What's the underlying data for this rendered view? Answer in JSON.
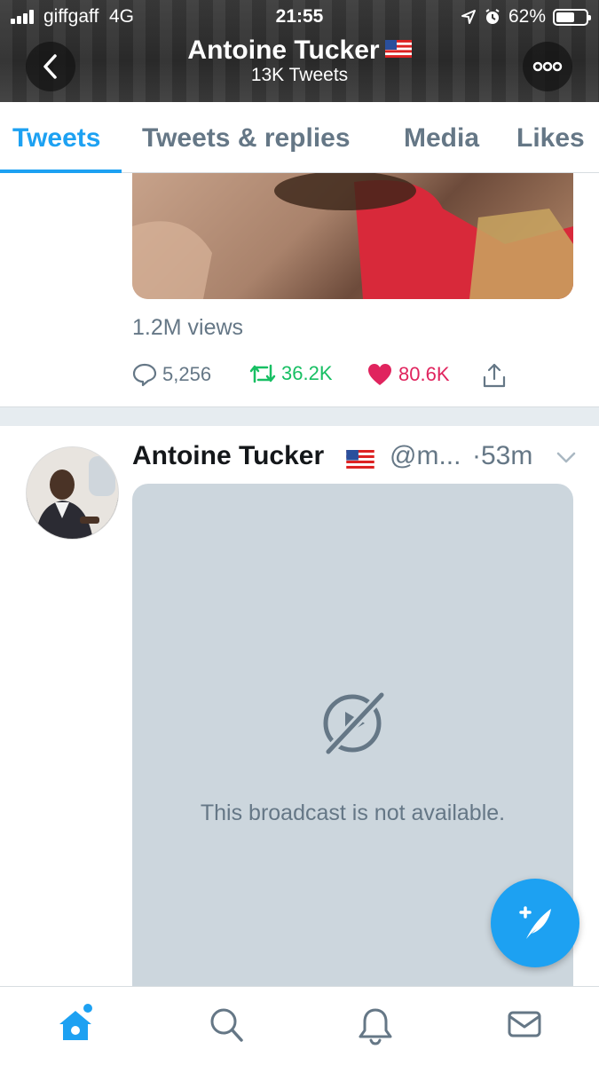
{
  "status_bar": {
    "carrier": "giffgaff",
    "network": "4G",
    "time": "21:55",
    "battery": "62%",
    "battery_level": 0.62
  },
  "header": {
    "name": "Antoine Tucker",
    "tweet_count": "13K Tweets",
    "back_icon": "chevron-left-icon",
    "more_icon": "more-dots-icon"
  },
  "tabs": [
    {
      "label": "Tweets",
      "active": true
    },
    {
      "label": "Tweets & replies",
      "active": false
    },
    {
      "label": "Media",
      "active": false
    },
    {
      "label": "Likes",
      "active": false
    }
  ],
  "tweet1": {
    "views": "1.2M views",
    "replies": "5,256",
    "retweets": "36.2K",
    "likes": "80.6K"
  },
  "tweet2": {
    "name": "Antoine Tucker",
    "handle": "@m...",
    "time": "·53m",
    "broadcast_message": "This broadcast is not available."
  },
  "colors": {
    "accent": "#1da1f2",
    "retweet": "#17bf63",
    "like": "#e0245e",
    "muted": "#657786"
  },
  "bottom_nav": [
    "home-icon",
    "search-icon",
    "notifications-icon",
    "messages-icon"
  ]
}
